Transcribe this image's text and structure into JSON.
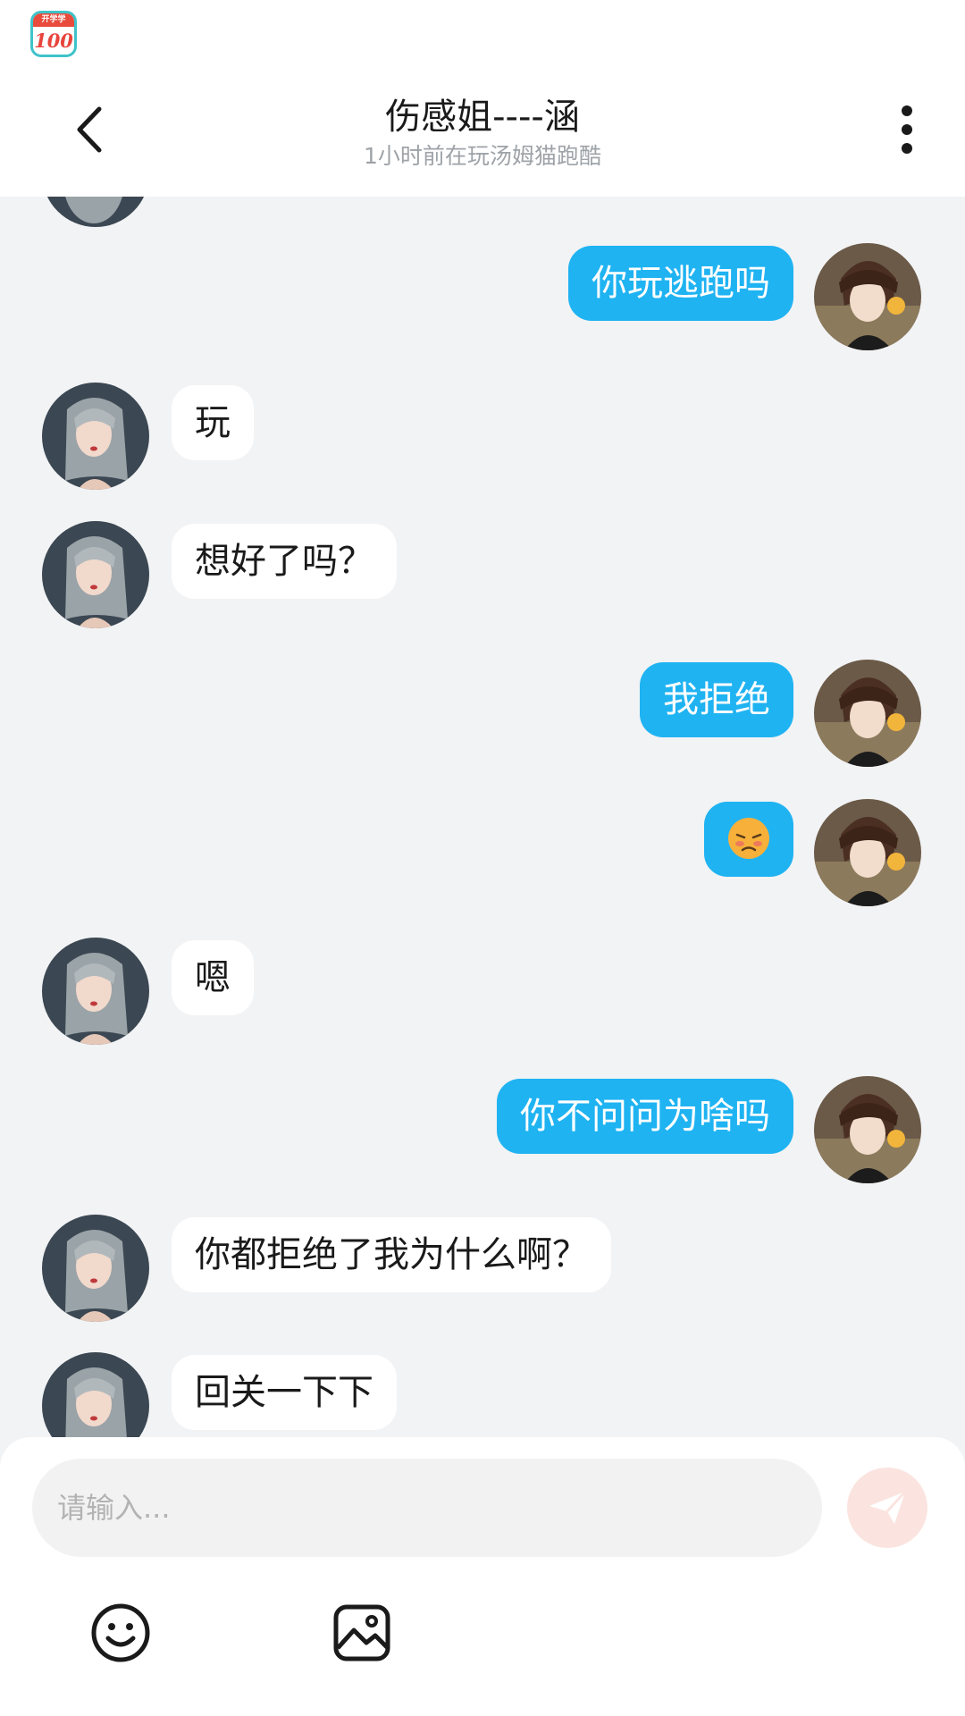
{
  "status_bar": {
    "app_badge_top": "开学学",
    "app_badge_number": "100"
  },
  "header": {
    "title": "伤感姐----涵",
    "subtitle": "1小时前在玩汤姆猫跑酷",
    "back_icon": "chevron-left-icon",
    "more_icon": "vertical-ellipsis-icon"
  },
  "messages": [
    {
      "side": "sent",
      "text": "你玩逃跑吗"
    },
    {
      "side": "received",
      "text": "玩"
    },
    {
      "side": "received",
      "text": "想好了吗？"
    },
    {
      "side": "sent",
      "text": "我拒绝"
    },
    {
      "side": "sent",
      "text": "",
      "emoji": "sad-face-emoji"
    },
    {
      "side": "received",
      "text": "嗯"
    },
    {
      "side": "sent",
      "text": "你不问问为啥吗"
    },
    {
      "side": "received",
      "text": "你都拒绝了我为什么啊？"
    },
    {
      "side": "received",
      "text": "回关一下下"
    }
  ],
  "input": {
    "placeholder": "请输入...",
    "value": "",
    "send_icon": "paper-plane-icon",
    "emoji_icon": "smiley-face-icon",
    "image_icon": "image-icon"
  },
  "colors": {
    "sent_bubble": "#1fb3f2",
    "received_bubble": "#ffffff",
    "chat_background": "#f2f3f5",
    "send_button": "#fbe4df"
  }
}
